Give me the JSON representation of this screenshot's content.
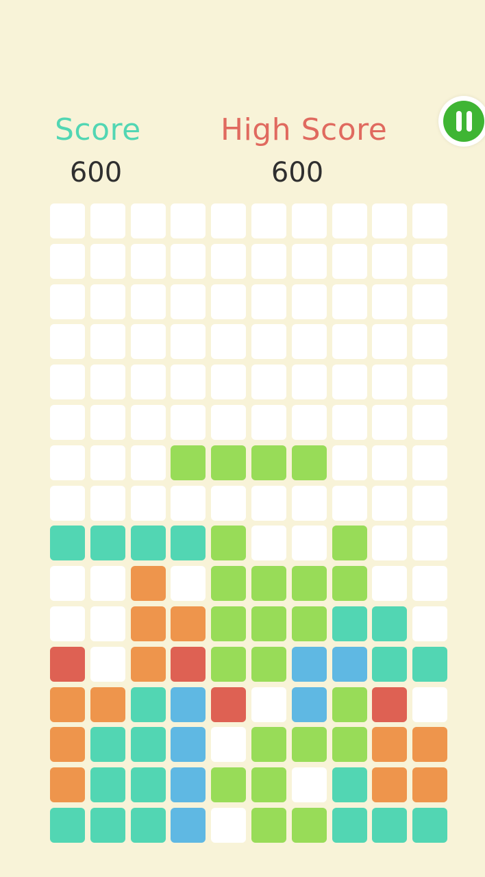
{
  "hud": {
    "score_label": "Score",
    "score_value": "600",
    "high_score_label": "High Score",
    "high_score_value": "600"
  },
  "icons": {
    "pause": "pause-icon"
  },
  "colors": {
    "background": "#f8f3d8",
    "score_label": "#52d6b3",
    "high_score_label": "#e06a5f",
    "pause_button": "#3fb534"
  },
  "board": {
    "columns": 10,
    "rows": 16,
    "palette": {
      ".": "#ffffff",
      "G": "#98dc58",
      "T": "#52d6b3",
      "O": "#ee954c",
      "R": "#de6153",
      "B": "#5fb8e3"
    },
    "grid": [
      "..........",
      "..........",
      "..........",
      "..........",
      "..........",
      "..........",
      "...GGGG...",
      "..........",
      "TTTTG..G..",
      "..O.GGGG..",
      "..OOGGGTT.",
      "R.ORGGBBTT",
      "OOTBR.BGR.",
      "OTTB.GGGOO",
      "OTTBGG.TOO",
      "TTTB.GGTTT"
    ]
  }
}
